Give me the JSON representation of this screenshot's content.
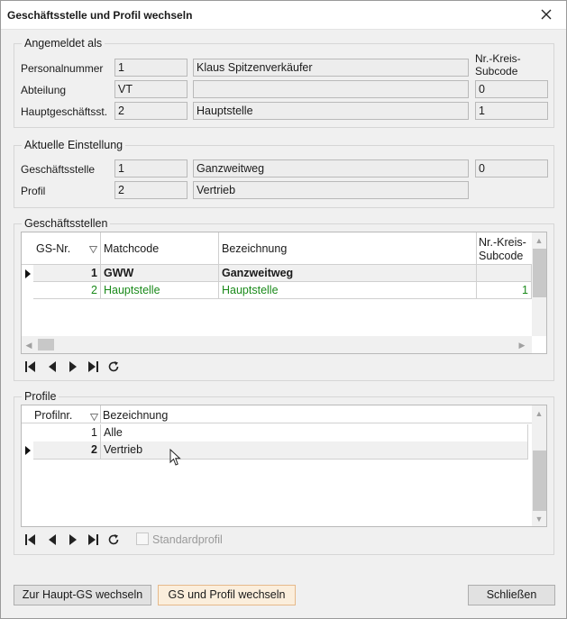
{
  "window": {
    "title": "Geschäftsstelle und Profil wechseln"
  },
  "angemeldet": {
    "group_label": "Angemeldet als",
    "col_header": "Nr.-Kreis-\nSubcode",
    "col_header_line1": "Nr.-Kreis-",
    "col_header_line2": "Subcode",
    "rows": [
      {
        "label": "Personalnummer",
        "nr": "1",
        "name": "Klaus Spitzenverkäufer",
        "subcode": ""
      },
      {
        "label": "Abteilung",
        "nr": "VT",
        "name": "",
        "subcode": "0"
      },
      {
        "label": "Hauptgeschäftsst.",
        "nr": "2",
        "name": "Hauptstelle",
        "subcode": "1"
      }
    ]
  },
  "aktuell": {
    "group_label": "Aktuelle Einstellung",
    "rows": [
      {
        "label": "Geschäftsstelle",
        "nr": "1",
        "name": "Ganzweitweg",
        "subcode": "0"
      },
      {
        "label": "Profil",
        "nr": "2",
        "name": "Vertrieb"
      }
    ]
  },
  "geschaeftsstellen": {
    "group_label": "Geschäftsstellen",
    "headers": {
      "gs_nr": "GS-Nr.",
      "matchcode": "Matchcode",
      "bezeichnung": "Bezeichnung",
      "subcode_line1": "Nr.-Kreis-",
      "subcode_line2": "Subcode"
    },
    "rows": [
      {
        "gs_nr": "1",
        "matchcode": "GWW",
        "bezeichnung": "Ganzweitweg",
        "subcode": "",
        "current": true
      },
      {
        "gs_nr": "2",
        "matchcode": "Hauptstelle",
        "bezeichnung": "Hauptstelle",
        "subcode": "1",
        "current": false
      }
    ]
  },
  "profile": {
    "group_label": "Profile",
    "headers": {
      "profilnr": "Profilnr.",
      "bezeichnung": "Bezeichnung"
    },
    "rows": [
      {
        "nr": "1",
        "bezeichnung": "Alle",
        "current": false
      },
      {
        "nr": "2",
        "bezeichnung": "Vertrieb",
        "current": true
      }
    ],
    "standardprofil_label": "Standardprofil",
    "standardprofil_checked": false
  },
  "buttons": {
    "zur_haupt_gs": "Zur Haupt-GS wechseln",
    "gs_profil": "GS und Profil wechseln",
    "schliessen": "Schließen"
  },
  "colors": {
    "highlight_row_text": "#1a8a1a",
    "primary_button_bg": "#fbeedc",
    "primary_button_border": "#e6b98a"
  },
  "icons": {
    "close": "close-icon",
    "first": "first-record-icon",
    "prev": "previous-record-icon",
    "next": "next-record-icon",
    "last": "last-record-icon",
    "refresh": "refresh-icon",
    "sort": "sort-indicator-icon",
    "row_pointer": "row-pointer-icon",
    "mouse": "mouse-cursor-icon"
  }
}
